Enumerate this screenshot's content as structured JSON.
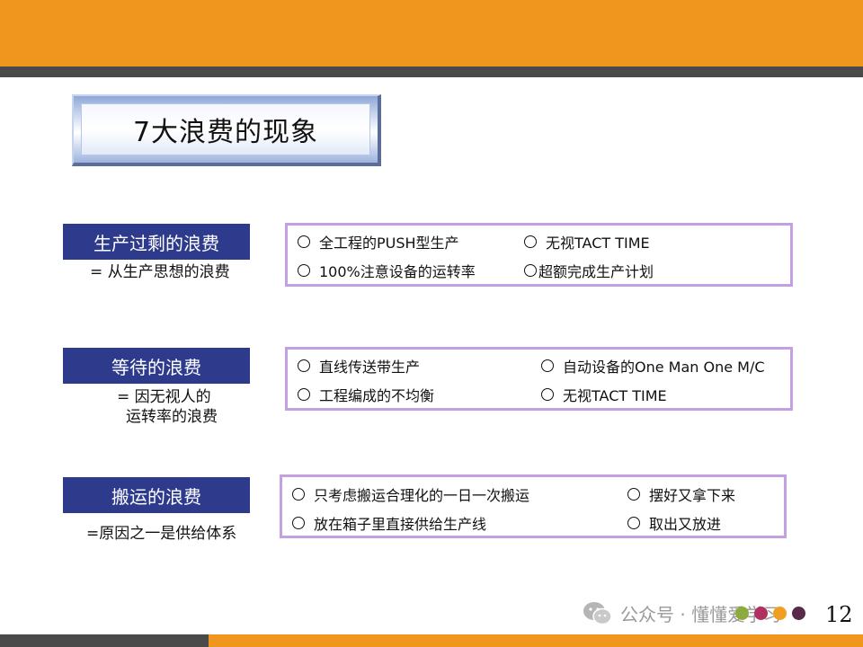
{
  "title": "7大浪费的现象",
  "sections": [
    {
      "label": "生产过剩的浪费",
      "sub_lines": [
        "= 从生产思想的浪费"
      ],
      "items": [
        "全工程的PUSH型生产",
        "无视TACT TIME",
        "100%注意设备的运转率",
        "超额完成生产计划"
      ]
    },
    {
      "label": "等待的浪费",
      "sub_lines": [
        "= 因无视人的",
        "运转率的浪费"
      ],
      "items": [
        "直线传送带生产",
        "自动设备的One Man One M/C",
        "工程编成的不均衡",
        "无视TACT TIME"
      ]
    },
    {
      "label": "搬运的浪费",
      "sub_lines": [
        "=原因之一是供给体系"
      ],
      "items": [
        "只考虑搬运合理化的一日一次搬运",
        "摆好又拿下来",
        "放在箱子里直接供给生产线",
        "取出又放进"
      ]
    }
  ],
  "watermark": "公众号 · 懂懂爱学习",
  "page_number": "12",
  "colors": {
    "top_band": "#F0961E",
    "dark_line": "#4A4A4A",
    "label_bg": "#2E3B8C",
    "panel_border": "#C3A0E2",
    "dots": [
      "#8DAA3C",
      "#B03060",
      "#F0A020",
      "#5A2A4A"
    ]
  },
  "icons": [
    "wechat-icon",
    "radio-circle-icon"
  ]
}
